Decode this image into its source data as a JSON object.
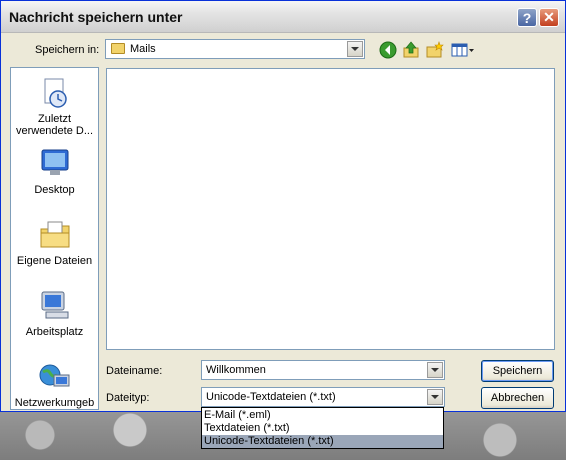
{
  "window": {
    "title": "Nachricht speichern unter",
    "help_label": "?",
    "close_label": "✕"
  },
  "lookin": {
    "label": "Speichern in:",
    "value": "Mails"
  },
  "places": [
    {
      "label": "Zuletzt verwendete D...",
      "icon": "recent-documents-icon"
    },
    {
      "label": "Desktop",
      "icon": "desktop-icon"
    },
    {
      "label": "Eigene Dateien",
      "icon": "my-documents-icon"
    },
    {
      "label": "Arbeitsplatz",
      "icon": "my-computer-icon"
    },
    {
      "label": "Netzwerkumgeb",
      "icon": "network-places-icon"
    }
  ],
  "filename": {
    "label": "Dateiname:",
    "value": "Willkommen"
  },
  "filetype": {
    "label": "Dateityp:",
    "value": "Unicode-Textdateien (*.txt)",
    "options": [
      "E-Mail (*.eml)",
      "Textdateien (*.txt)",
      "Unicode-Textdateien (*.txt)"
    ]
  },
  "buttons": {
    "save": "Speichern",
    "cancel": "Abbrechen"
  },
  "colors": {
    "titlebar_close": "#c3401f",
    "dropdown_selected": "#9aa6b8",
    "dialog_bg": "#ece9d8"
  }
}
